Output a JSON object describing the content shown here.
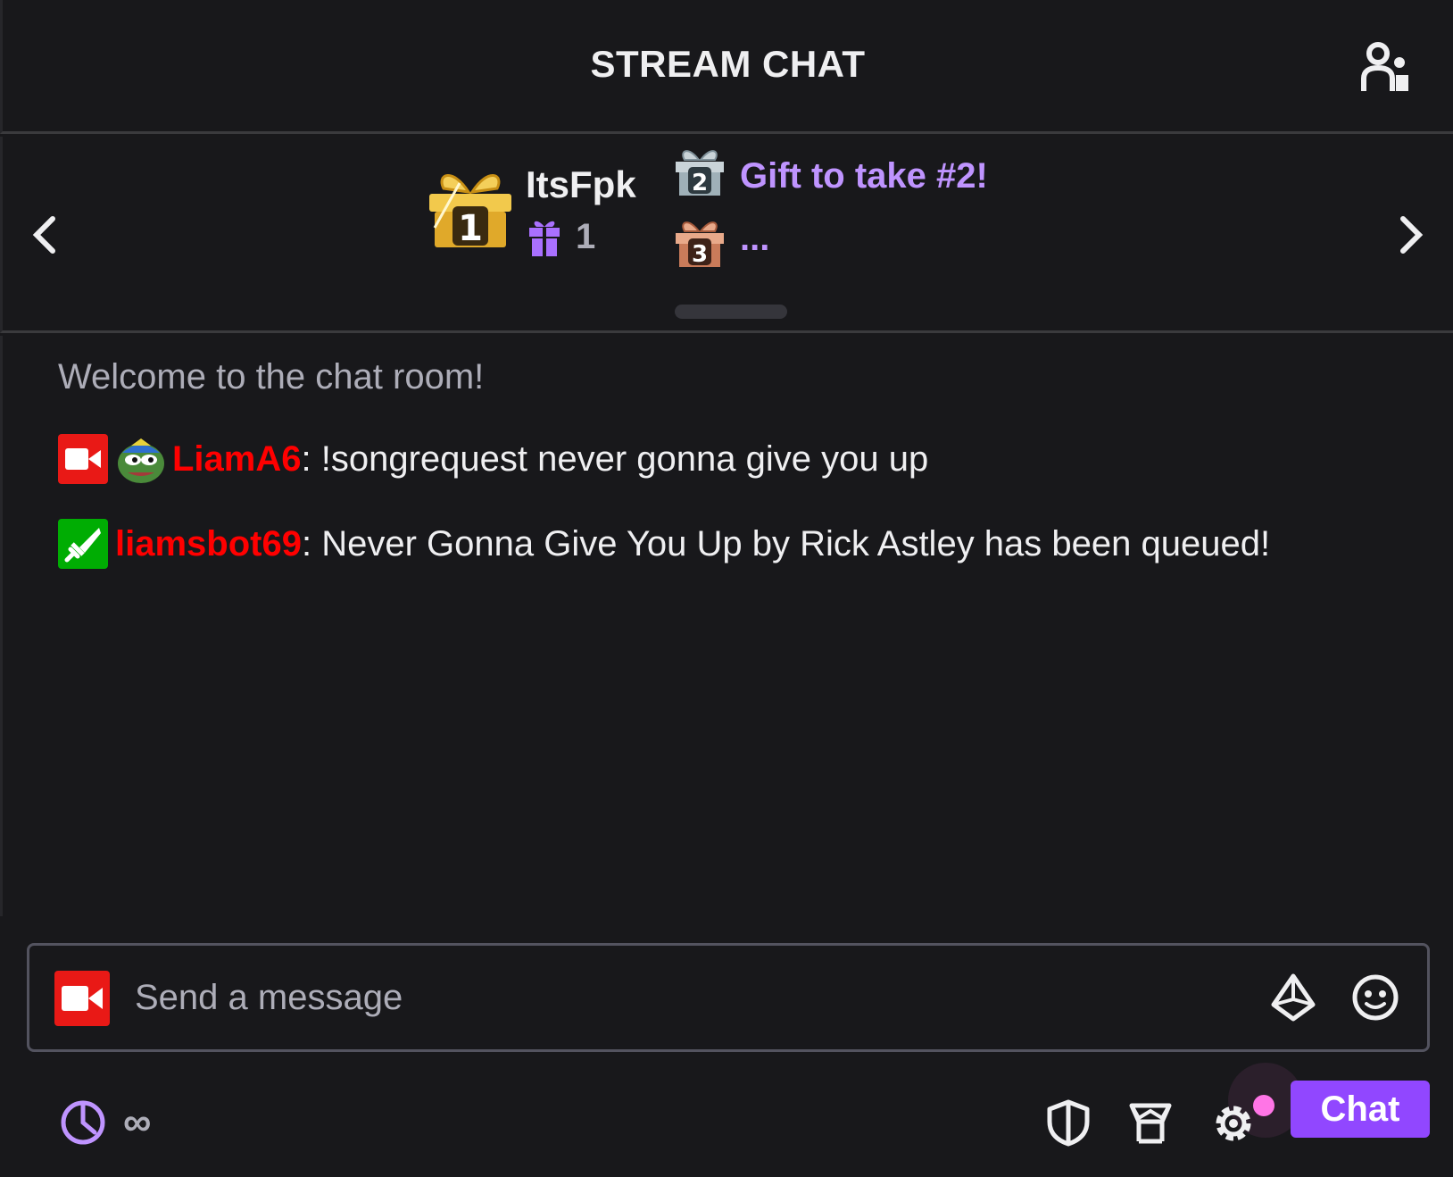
{
  "header": {
    "title": "STREAM CHAT",
    "users_icon": "community-icon"
  },
  "gift_leaderboard": {
    "prev_icon": "chevron-left-icon",
    "next_icon": "chevron-right-icon",
    "first": {
      "rank_icon": "gift-rank-1-icon",
      "name": "ItsFpk",
      "gift_icon": "gift-icon",
      "count": "1"
    },
    "second": {
      "rank_icon": "gift-rank-2-icon",
      "label": "Gift to take #2!"
    },
    "third": {
      "rank_icon": "gift-rank-3-icon",
      "label": "..."
    }
  },
  "chat": {
    "welcome": "Welcome to the chat room!",
    "messages": [
      {
        "badges": [
          "broadcaster-badge-icon",
          "pepe-emote-icon"
        ],
        "user": "LiamA6",
        "separator": ":",
        "text": " !songrequest never gonna give you up",
        "user_color": "#ff0000"
      },
      {
        "badges": [
          "moderator-badge-icon"
        ],
        "user": "liamsbot69",
        "separator": ":",
        "text": " Never Gonna Give You Up by Rick Astley has been queued!",
        "user_color": "#ff0000"
      }
    ]
  },
  "input": {
    "placeholder": "Send a message",
    "value": "",
    "badge_icon": "broadcaster-badge-icon",
    "bits_icon": "bits-icon",
    "emote_icon": "smiley-icon"
  },
  "footer": {
    "timer_icon": "timer-icon",
    "infinity": "∞",
    "shield_icon": "shield-icon",
    "prime_icon": "prime-icon",
    "settings_icon": "gear-icon",
    "chat_button": "Chat"
  },
  "colors": {
    "background": "#18181b",
    "accent": "#9147ff",
    "accent_light": "#bf94ff",
    "broadcaster": "#e91916",
    "moderator": "#00ad03",
    "notification": "#ff75e6"
  }
}
